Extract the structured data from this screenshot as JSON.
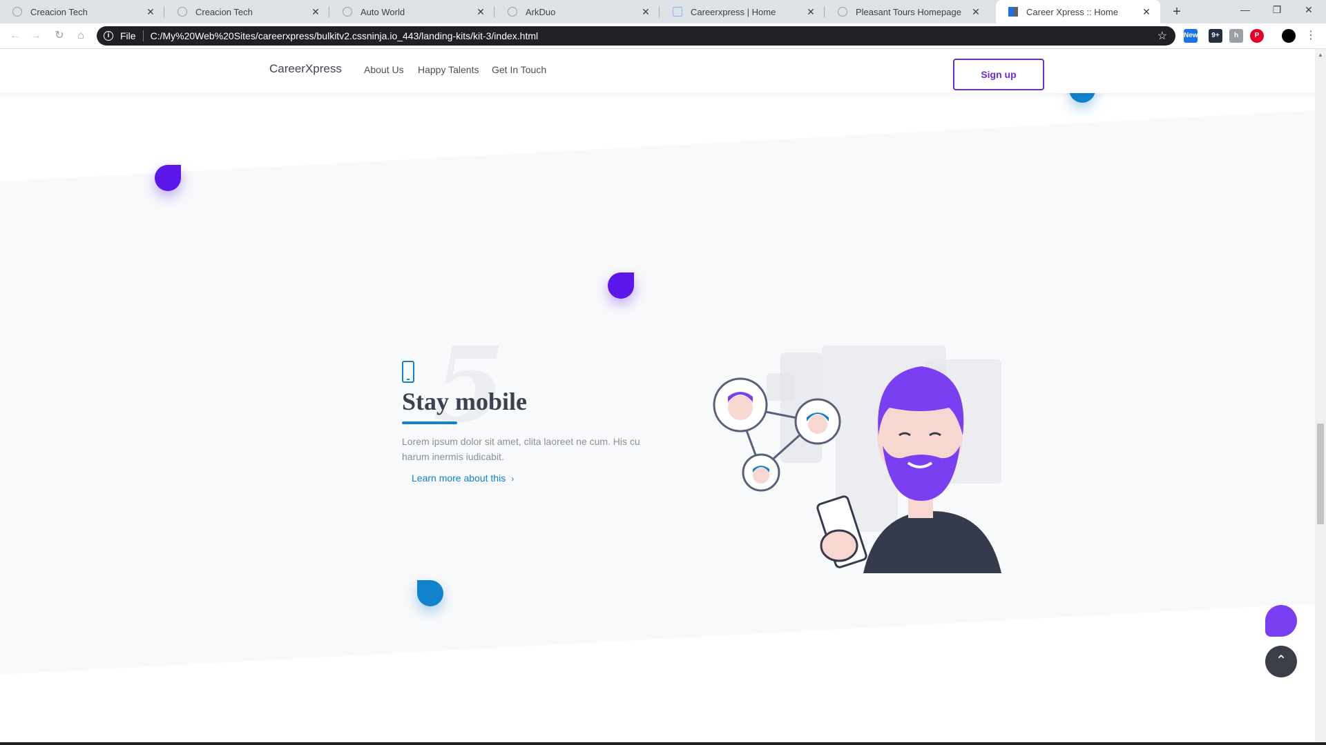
{
  "browser": {
    "tabs": [
      {
        "title": "Creacion Tech",
        "icon": "globe-icon",
        "active": false
      },
      {
        "title": "Creacion Tech",
        "icon": "globe-icon",
        "active": false
      },
      {
        "title": "Auto World",
        "icon": "globe-icon",
        "active": false
      },
      {
        "title": "ArkDuo",
        "icon": "globe-icon",
        "active": false
      },
      {
        "title": "Careerxpress | Home",
        "icon": "chart-icon",
        "active": false
      },
      {
        "title": "Pleasant Tours Homepage",
        "icon": "globe-icon",
        "active": false
      },
      {
        "title": "Career Xpress :: Home",
        "icon": "grid-icon",
        "active": true
      }
    ],
    "close_glyph": "✕",
    "new_tab_glyph": "+",
    "window_controls": {
      "minimize": "—",
      "restore": "❐",
      "close": "✕"
    },
    "address": {
      "scheme_label": "File",
      "url": "C:/My%20Web%20Sites/careerxpress/bulkitv2.cssninja.io_443/landing-kits/kit-3/index.html"
    },
    "extensions": [
      {
        "name": "news-extension-icon",
        "text": "New",
        "color": "#1a73e8"
      },
      {
        "name": "amazon-extension-icon",
        "text": "9+",
        "color": "#232f3e"
      },
      {
        "name": "translate-extension-icon",
        "text": "h",
        "color": "#9aa0a6"
      },
      {
        "name": "pinterest-extension-icon",
        "text": "P",
        "color": "#e60023"
      },
      {
        "name": "profile-avatar-icon",
        "text": "",
        "color": "#000000"
      }
    ]
  },
  "site": {
    "brand": "CareerXpress",
    "nav": [
      "About Us",
      "Happy Talents",
      "Get In Touch"
    ],
    "signup_label": "Sign up",
    "accent_purple": "#6c2bd9",
    "accent_blue": "#1282cc"
  },
  "feature": {
    "number": "5",
    "title": "Stay mobile",
    "text": "Lorem ipsum dolor sit amet, clita laoreet ne cum. His cu harum inermis iudicabit.",
    "link": "Learn more about this",
    "icon": "smartphone-icon"
  },
  "floating": {
    "to_top_glyph": "⌃"
  }
}
